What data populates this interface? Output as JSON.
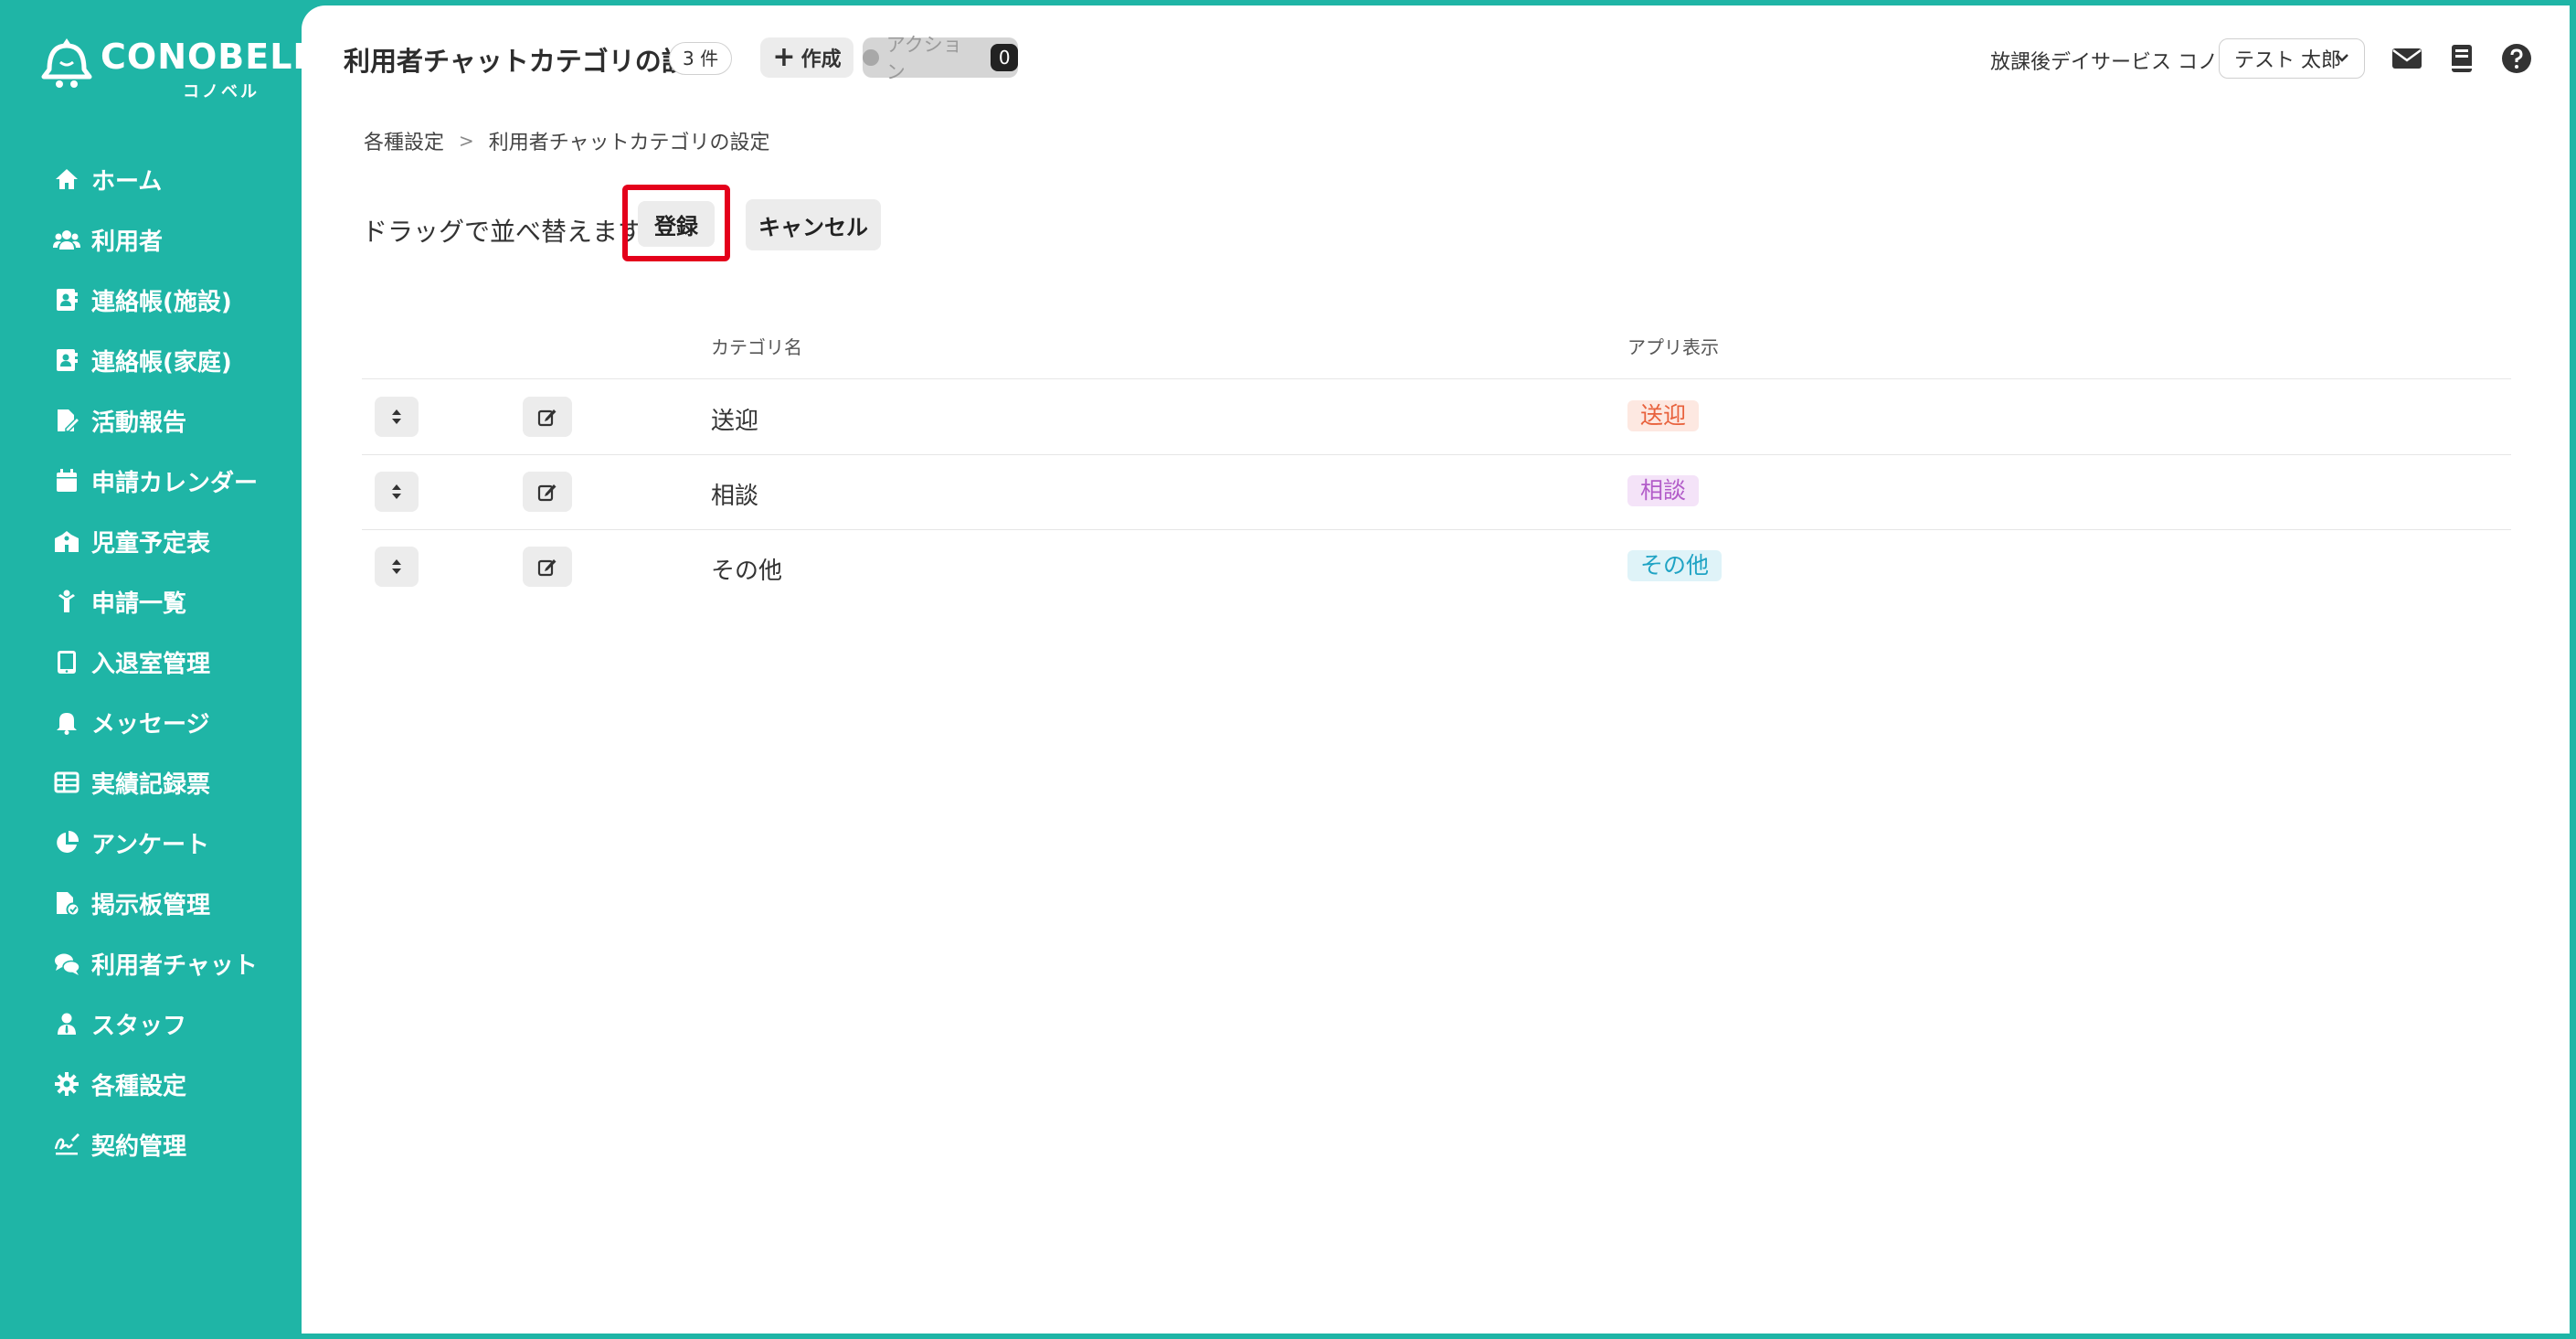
{
  "brand": {
    "name": "CONOBELL",
    "sub": "コノベル"
  },
  "sidebar": {
    "items": [
      {
        "label": "ホーム",
        "icon": "home-icon"
      },
      {
        "label": "利用者",
        "icon": "users-icon"
      },
      {
        "label": "連絡帳(施設)",
        "icon": "contact-book-icon"
      },
      {
        "label": "連絡帳(家庭)",
        "icon": "contact-book-icon"
      },
      {
        "label": "活動報告",
        "icon": "report-icon"
      },
      {
        "label": "申請カレンダー",
        "icon": "calendar-icon"
      },
      {
        "label": "児童予定表",
        "icon": "school-icon"
      },
      {
        "label": "申請一覧",
        "icon": "child-icon"
      },
      {
        "label": "入退室管理",
        "icon": "tablet-icon"
      },
      {
        "label": "メッセージ",
        "icon": "bell-icon"
      },
      {
        "label": "実績記録票",
        "icon": "table-icon"
      },
      {
        "label": "アンケート",
        "icon": "pie-chart-icon"
      },
      {
        "label": "掲示板管理",
        "icon": "board-icon"
      },
      {
        "label": "利用者チャット",
        "icon": "chat-icon"
      },
      {
        "label": "スタッフ",
        "icon": "staff-icon"
      },
      {
        "label": "各種設定",
        "icon": "gear-icon"
      },
      {
        "label": "契約管理",
        "icon": "signature-icon"
      }
    ]
  },
  "header": {
    "title": "利用者チャットカテゴリの設定",
    "count": "3 件",
    "create_label": "作成",
    "action_label": "アクション",
    "action_count": "0",
    "org_name": "放課後デイサービス コノベル",
    "user_name": "テスト 太郎"
  },
  "breadcrumb": {
    "items": [
      "各種設定",
      "利用者チャットカテゴリの設定"
    ]
  },
  "toolbar": {
    "drag_text": "ドラッグで並べ替えます。",
    "register_label": "登録",
    "cancel_label": "キャンセル"
  },
  "table": {
    "headers": {
      "name": "カテゴリ名",
      "app": "アプリ表示"
    },
    "rows": [
      {
        "name": "送迎",
        "tag": "送迎",
        "tag_color": "#e8613c",
        "tag_bg": "#fde8e1"
      },
      {
        "name": "相談",
        "tag": "相談",
        "tag_color": "#b25cc9",
        "tag_bg": "#f4e3f8"
      },
      {
        "name": "その他",
        "tag": "その他",
        "tag_color": "#1fa3c4",
        "tag_bg": "#dff3f8"
      }
    ]
  },
  "colors": {
    "sidebar_bg": "#1fb5a6",
    "highlight": "#e4001b"
  }
}
